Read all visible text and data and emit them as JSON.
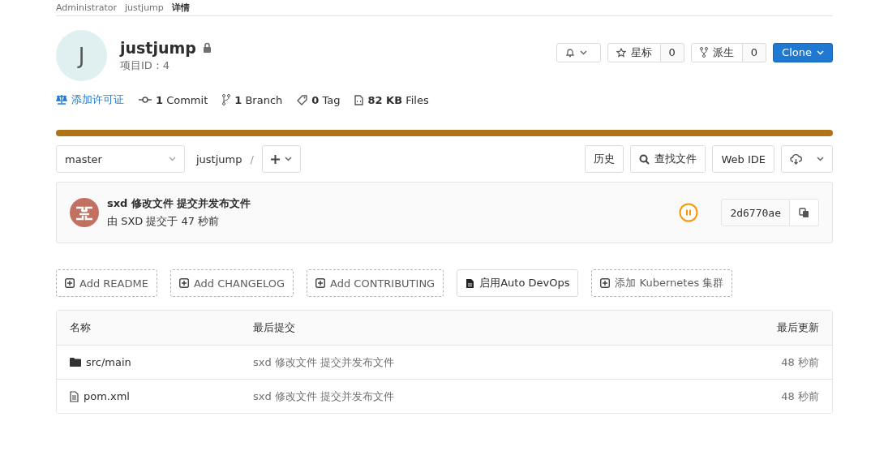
{
  "breadcrumb": [
    "Administrator",
    "justjump",
    "详情"
  ],
  "project": {
    "avatar_letter": "J",
    "name": "justjump",
    "private": true,
    "id_label": "项目ID：4"
  },
  "actions": {
    "star": {
      "label": "星标",
      "count": "0"
    },
    "fork": {
      "label": "派生",
      "count": "0"
    },
    "clone": {
      "label": "Clone"
    }
  },
  "stats": [
    {
      "kind": "license",
      "text": "添加许可证"
    },
    {
      "kind": "commit",
      "text": "**1** Commit"
    },
    {
      "kind": "branch",
      "text": "**1** Branch"
    },
    {
      "kind": "tag",
      "text": "**0** Tag"
    },
    {
      "kind": "files",
      "text": "**82 KB** Files"
    }
  ],
  "language_bar": {
    "color": "#b07219"
  },
  "toolbar": {
    "branch": "master",
    "path": "justjump",
    "separator": "/",
    "history": "历史",
    "find_file": "查找文件",
    "web_ide": "Web IDE"
  },
  "last_commit": {
    "title": "sxd 修改文件 提交并发布文件",
    "meta": "由 SXD 提交于 47 秒前",
    "sha": "2d6770ae"
  },
  "quick_actions": [
    {
      "kind": "add",
      "label": "Add README"
    },
    {
      "kind": "add",
      "label": "Add CHANGELOG"
    },
    {
      "kind": "add",
      "label": "Add CONTRIBUTING"
    },
    {
      "kind": "enable",
      "label": "启用Auto DevOps"
    },
    {
      "kind": "add",
      "label": "添加 Kubernetes 集群"
    }
  ],
  "table": {
    "columns": [
      "名称",
      "最后提交",
      "最后更新"
    ],
    "rows": [
      {
        "kind": "folder",
        "name": "src/main",
        "commit": "sxd 修改文件 提交并发布文件",
        "updated": "48 秒前"
      },
      {
        "kind": "file",
        "name": "pom.xml",
        "commit": "sxd 修改文件 提交并发布文件",
        "updated": "48 秒前"
      }
    ]
  }
}
